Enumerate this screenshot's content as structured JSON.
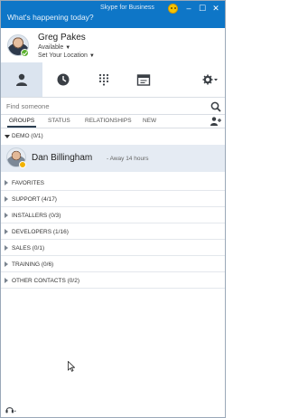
{
  "window": {
    "title": "Skype for Business",
    "note_placeholder": "What's happening today?"
  },
  "profile": {
    "name": "Greg Pakes",
    "status": "Available",
    "location": "Set Your Location"
  },
  "nav": {
    "tabs": [
      "contacts",
      "conversations",
      "phone",
      "meetings"
    ],
    "options_icon": "gear-icon"
  },
  "search": {
    "placeholder": "Find someone"
  },
  "filters": {
    "tabs": [
      "GROUPS",
      "STATUS",
      "RELATIONSHIPS",
      "NEW"
    ],
    "active": "GROUPS"
  },
  "groups": [
    {
      "label": "DEMO (0/1)",
      "expanded": true,
      "contacts": [
        {
          "name": "Dan Billingham",
          "status": "- Away 14 hours",
          "presence_color": "#f2b200"
        }
      ]
    },
    {
      "label": "FAVORITES",
      "expanded": false
    },
    {
      "label": "SUPPORT (4/17)",
      "expanded": false
    },
    {
      "label": "INSTALLERS (0/3)",
      "expanded": false
    },
    {
      "label": "DEVELOPERS (1/16)",
      "expanded": false
    },
    {
      "label": "SALES (0/1)",
      "expanded": false
    },
    {
      "label": "TRAINING (0/6)",
      "expanded": false
    },
    {
      "label": "OTHER CONTACTS (0/2)",
      "expanded": false
    }
  ],
  "colors": {
    "titlebar": "#0e76c7",
    "available": "#5cb130",
    "away": "#f2b200",
    "selected_row": "#e5ebf3"
  }
}
